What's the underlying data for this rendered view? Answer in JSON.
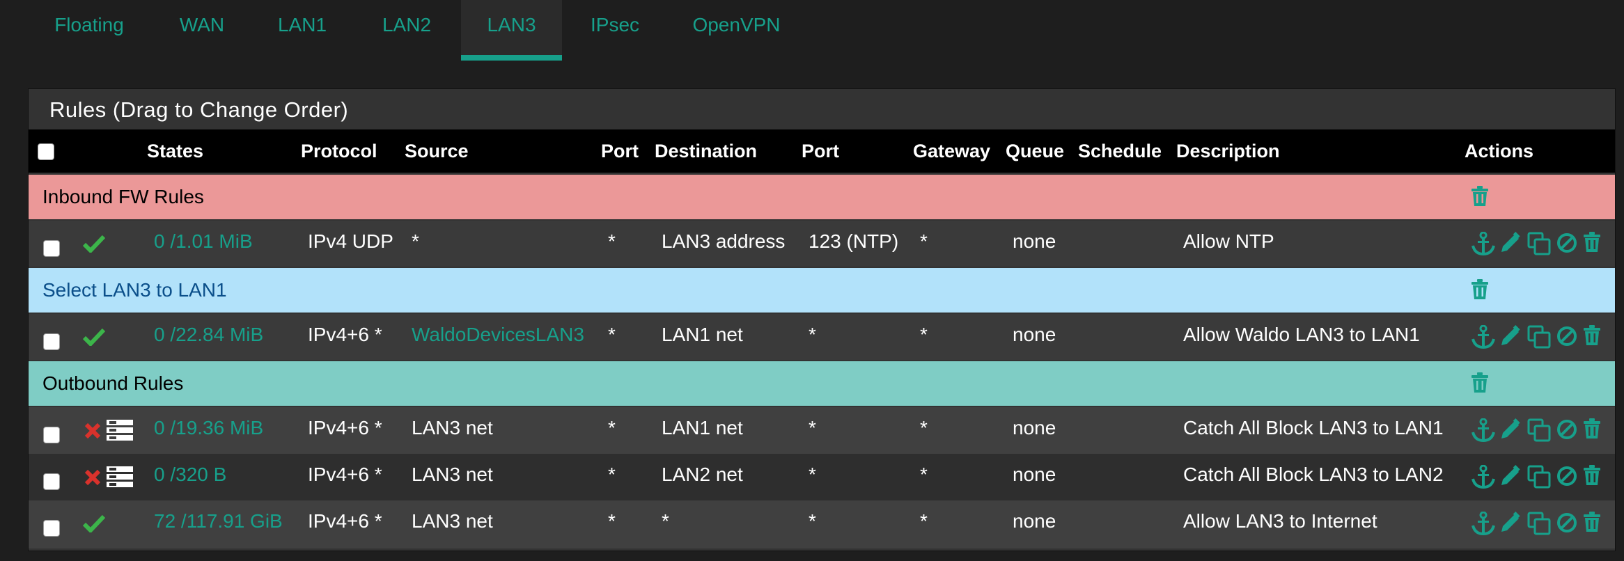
{
  "tabs": [
    {
      "label": "Floating",
      "active": false
    },
    {
      "label": "WAN",
      "active": false
    },
    {
      "label": "LAN1",
      "active": false
    },
    {
      "label": "LAN2",
      "active": false
    },
    {
      "label": "LAN3",
      "active": true
    },
    {
      "label": "IPsec",
      "active": false
    },
    {
      "label": "OpenVPN",
      "active": false
    }
  ],
  "panel": {
    "title": "Rules (Drag to Change Order)"
  },
  "columns": {
    "states": "States",
    "protocol": "Protocol",
    "source": "Source",
    "port1": "Port",
    "destination": "Destination",
    "port2": "Port",
    "gateway": "Gateway",
    "queue": "Queue",
    "schedule": "Schedule",
    "description": "Description",
    "actions": "Actions"
  },
  "separators": {
    "inbound": "Inbound FW Rules",
    "select": "Select LAN3 to LAN1",
    "outbound": "Outbound Rules"
  },
  "rules": [
    {
      "status": "pass",
      "states": "0 /1.01 MiB",
      "protocol": "IPv4 UDP",
      "source": "*",
      "source_link": false,
      "port1": "*",
      "destination": "LAN3 address",
      "port2": "123 (NTP)",
      "gateway": "*",
      "queue": "none",
      "description": "Allow NTP"
    },
    {
      "status": "pass",
      "states": "0 /22.84 MiB",
      "protocol": "IPv4+6 *",
      "source": "WaldoDevicesLAN3",
      "source_link": true,
      "port1": "*",
      "destination": "LAN1 net",
      "port2": "*",
      "gateway": "*",
      "queue": "none",
      "description": "Allow Waldo LAN3 to LAN1"
    },
    {
      "status": "block",
      "states": "0 /19.36 MiB",
      "protocol": "IPv4+6 *",
      "source": "LAN3 net",
      "source_link": false,
      "port1": "*",
      "destination": "LAN1 net",
      "port2": "*",
      "gateway": "*",
      "queue": "none",
      "description": "Catch All Block LAN3 to LAN1"
    },
    {
      "status": "block",
      "states": "0 /320 B",
      "protocol": "IPv4+6 *",
      "source": "LAN3 net",
      "source_link": false,
      "port1": "*",
      "destination": "LAN2 net",
      "port2": "*",
      "gateway": "*",
      "queue": "none",
      "description": "Catch All Block LAN3 to LAN2"
    },
    {
      "status": "pass",
      "states": "72 /117.91 GiB",
      "protocol": "IPv4+6 *",
      "source": "LAN3 net",
      "source_link": false,
      "port1": "*",
      "destination": "*",
      "port2": "*",
      "gateway": "*",
      "queue": "none",
      "description": "Allow LAN3 to Internet"
    }
  ],
  "colors": {
    "accent": "#17a08b",
    "pass": "#3cb54a",
    "block": "#d9322c",
    "sep_pink": "#eb9898",
    "sep_blue": "#b2e2fa",
    "sep_teal": "#7fcdc5"
  },
  "icons": {
    "pass": "check-icon",
    "block": "x-icon",
    "log": "log-icon",
    "anchor": "anchor-icon",
    "edit": "pencil-icon",
    "copy": "copy-icon",
    "disable": "disable-icon",
    "delete": "trash-icon"
  }
}
